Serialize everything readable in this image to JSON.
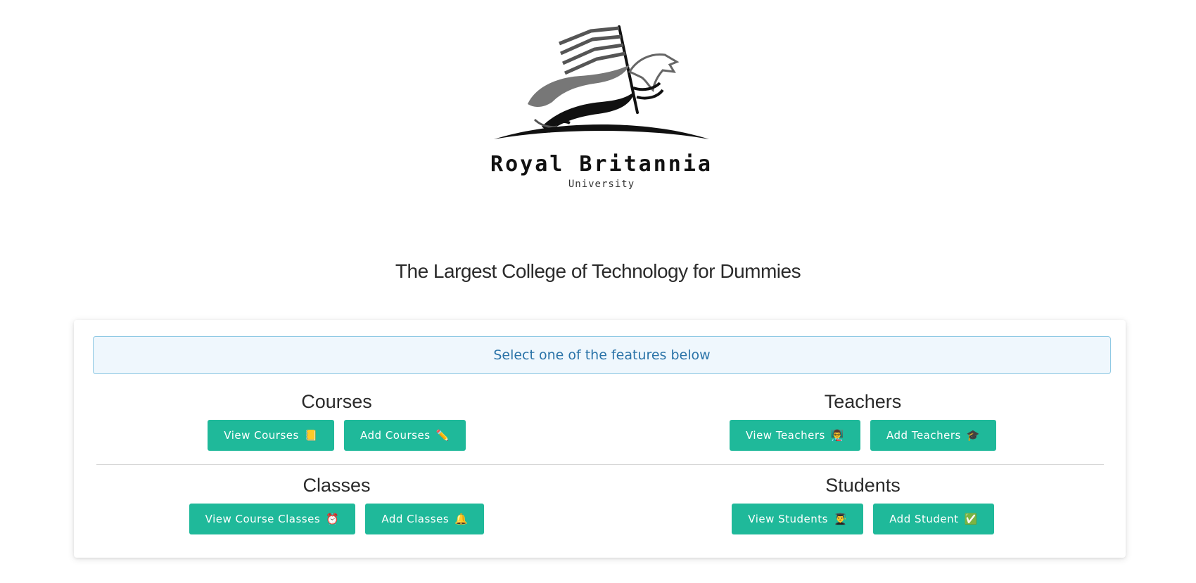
{
  "logo": {
    "name": "Royal Britannia",
    "subtitle": "University"
  },
  "tagline": "The Largest College of Technology for Dummies",
  "alert": {
    "text": "Select one of the features below"
  },
  "sections": {
    "courses": {
      "title": "Courses",
      "buttons": [
        {
          "label": "View Courses",
          "emoji": "📒"
        },
        {
          "label": "Add Courses",
          "emoji": "✏️"
        }
      ]
    },
    "teachers": {
      "title": "Teachers",
      "buttons": [
        {
          "label": "View Teachers",
          "emoji": "👨‍🏫"
        },
        {
          "label": "Add Teachers",
          "emoji": "🎓"
        }
      ]
    },
    "classes": {
      "title": "Classes",
      "buttons": [
        {
          "label": "View Course Classes",
          "emoji": "⏰"
        },
        {
          "label": "Add Classes",
          "emoji": "🔔"
        }
      ]
    },
    "students": {
      "title": "Students",
      "buttons": [
        {
          "label": "View Students",
          "emoji": "👨‍🎓"
        },
        {
          "label": "Add Student",
          "emoji": "✅"
        }
      ]
    }
  },
  "colors": {
    "button": "#1fb99a",
    "alert_bg": "#eff7fd",
    "alert_border": "#8fc9e4",
    "alert_text": "#2a73a8"
  }
}
